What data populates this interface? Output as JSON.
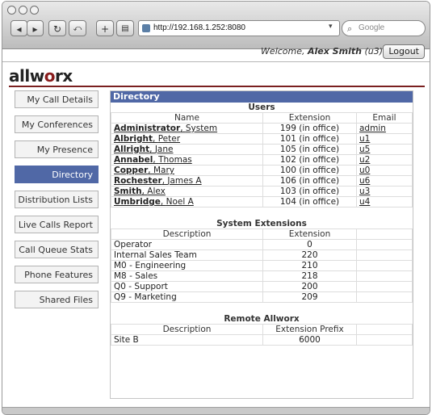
{
  "browser": {
    "url": "http://192.168.1.252:8080",
    "search_placeholder": "Google"
  },
  "header": {
    "welcome_prefix": "Welcome,",
    "user_name": "Alex Smith",
    "user_ext": "(u3)",
    "logout_label": "Logout",
    "logo_text_a": "allw",
    "logo_text_b": "o",
    "logo_text_c": "rx"
  },
  "sidebar": {
    "items": [
      {
        "label": "My Call Details"
      },
      {
        "label": "My Conferences"
      },
      {
        "label": "My Presence"
      },
      {
        "label": "Directory"
      },
      {
        "label": "Distribution Lists"
      },
      {
        "label": "Live Calls Report"
      },
      {
        "label": "Call Queue Stats"
      },
      {
        "label": "Phone Features"
      },
      {
        "label": "Shared Files"
      }
    ],
    "active": "Directory"
  },
  "directory": {
    "title": "Directory",
    "users": {
      "section_title": "Users",
      "headers": [
        "Name",
        "Extension",
        "Email"
      ],
      "rows": [
        {
          "last": "Administrator",
          "first": "System",
          "ext": "199 (in office)",
          "email": "admin"
        },
        {
          "last": "Albright",
          "first": "Peter",
          "ext": "101 (in office)",
          "email": "u1"
        },
        {
          "last": "Allright",
          "first": "Jane",
          "ext": "105 (in office)",
          "email": "u5"
        },
        {
          "last": "Annabel",
          "first": "Thomas",
          "ext": "102 (in office)",
          "email": "u2"
        },
        {
          "last": "Copper",
          "first": "Mary",
          "ext": "100 (in office)",
          "email": "u0"
        },
        {
          "last": "Rochester",
          "first": "James A",
          "ext": "106 (in office)",
          "email": "u6"
        },
        {
          "last": "Smith",
          "first": "Alex",
          "ext": "103 (in office)",
          "email": "u3"
        },
        {
          "last": "Umbridge",
          "first": "Noel A",
          "ext": "104 (in office)",
          "email": "u4"
        }
      ]
    },
    "system": {
      "section_title": "System Extensions",
      "headers": [
        "Description",
        "Extension"
      ],
      "rows": [
        {
          "desc": "Operator",
          "ext": "0"
        },
        {
          "desc": "Internal Sales Team",
          "ext": "220"
        },
        {
          "desc": "M0 - Engineering",
          "ext": "210"
        },
        {
          "desc": "M8 - Sales",
          "ext": "218"
        },
        {
          "desc": "Q0 - Support",
          "ext": "200"
        },
        {
          "desc": "Q9 - Marketing",
          "ext": "209"
        }
      ]
    },
    "remote": {
      "section_title": "Remote Allworx",
      "headers": [
        "Description",
        "Extension Prefix"
      ],
      "rows": [
        {
          "desc": "Site B",
          "ext": "6000"
        }
      ]
    }
  }
}
